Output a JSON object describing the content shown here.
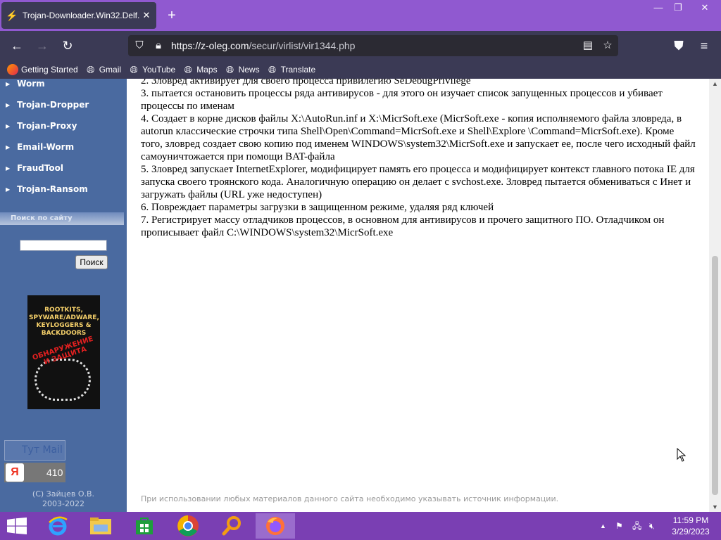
{
  "browser": {
    "tab_title": "Trojan-Downloader.Win32.Delf.",
    "url_domain": "https://z-oleg.com",
    "url_path": "/secur/virlist/vir1344.php",
    "bookmarks": [
      "Getting Started",
      "Gmail",
      "YouTube",
      "Maps",
      "News",
      "Translate"
    ]
  },
  "sidebar": {
    "items": [
      "Worm",
      "Trojan-Dropper",
      "Trojan-Proxy",
      "Email-Worm",
      "FraudTool",
      "Trojan-Ransom"
    ],
    "search_heading": "Поиск по сайту",
    "search_button": "Поиск",
    "book": {
      "title": "ROOTKITS, SPYWARE/ADWARE, KEYLOGGERS & BACKDOORS",
      "subtitle": "ОБНАРУЖЕНИЕ И ЗАЩИТА"
    },
    "badge1": "Тyт Mail",
    "badge2_letter": "Я",
    "badge2_count": "410",
    "copyright_line1": "(C) Зайцев О.В.",
    "copyright_line2": "2003-2022"
  },
  "content": {
    "lines": [
      "2. Зловред активирует для своего процесса привилегию SeDebugPrivilege",
      "3. пытается остановить процессы ряда антивирусов - для этого он изучает список запущенных процессов и убивает процессы по именам",
      "4. Создает в корне дисков файлы X:\\AutoRun.inf и X:\\MicrSoft.exe (MicrSoft.exe - копия исполняемого файла зловреда, в autorun классические строчки типа Shell\\Open\\Command=MicrSoft.exe и Shell\\Explore \\Command=MicrSoft.exe). Кроме того, зловред создает свою копию под именем WINDOWS\\system32\\MicrSoft.exe и запускает ее, после чего исходный файл самоуничтожается при помощи BAT-файла",
      "5. Зловред запускает InternetExplorer, модифицирует память его процесса и модифицирует контекст главного потока IE для запуска своего троянского кода. Аналогичную операцию он делает с svchost.exe. Зловред пытается обмениваться с Инет и загружать файлы (URL уже недоступен)",
      "6. Повреждает параметры загрузки в защищенном режиме, удаляя ряд ключей",
      "7. Регистрирует массу отладчиков процессов, в основном для антивирусов и прочего защитного ПО. Отладчиком он прописывает файл C:\\WINDOWS\\system32\\MicrSoft.exe"
    ],
    "footer": "При использовании любых материалов данного сайта необходимо указывать источник информации."
  },
  "taskbar": {
    "time": "11:59 PM",
    "date": "3/29/2023"
  }
}
